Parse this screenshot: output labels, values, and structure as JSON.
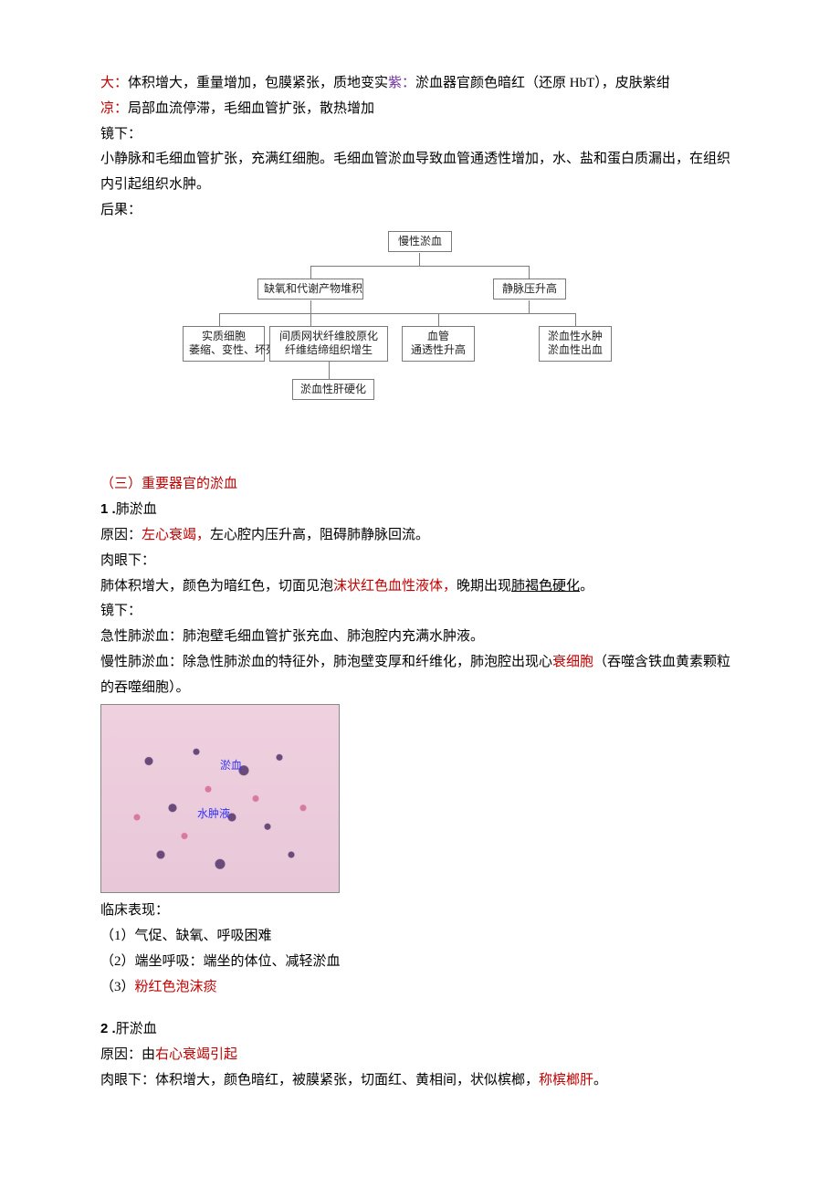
{
  "intro": {
    "line1_red": "大：",
    "line1_rest_a": "体积增大，重量增加，包膜紧张，质地变实",
    "line1_purp": "紫：",
    "line1_rest_b": "淤血器官颜色暗红（还原 HbT），皮肤紫绀",
    "line2_red": "凉：",
    "line2_rest": "局部血流停滞，毛细血管扩张，散热增加",
    "line3": "镜下：",
    "line4": "小静脉和毛细血管扩张，充满红细胞。毛细血管淤血导致血管通透性增加，水、盐和蛋白质漏出，在组织内引起组织水肿。",
    "line5": "后果："
  },
  "flowchart": {
    "top": "慢性淤血",
    "l2a": "缺氧和代谢产物堆积",
    "l2b": "静脉压升高",
    "l3a_1": "实质细胞",
    "l3a_2": "萎缩、变性、坏死",
    "l3b_1": "间质网状纤维胶原化",
    "l3b_2": "纤维结缔组织增生",
    "l3c_1": "血管",
    "l3c_2": "通透性升高",
    "l3d_1": "淤血性水肿",
    "l3d_2": "淤血性出血",
    "bottom": "淤血性肝硬化"
  },
  "section3": {
    "heading": "（三）重要器官的淤血",
    "item1_num": "1 .",
    "item1_title": "肺淤血",
    "cause_label": "原因：",
    "cause_red": "左心衰竭，",
    "cause_rest": "左心腔内压升高，阻碍肺静脉回流。",
    "gross_label": "肉眼下：",
    "gross_a": "肺体积增大，颜色为暗红色，切面见泡",
    "gross_red": "沫状红色血性液体，",
    "gross_b": "晚期出现",
    "gross_u": "肺褐色硬化",
    "gross_c": "。",
    "micro_label": "镜下：",
    "micro1": "急性肺淤血：肺泡壁毛细血管扩张充血、肺泡腔内充满水肿液。",
    "micro2_a": "慢性肺淤血：除急性肺淤血的特征外，肺泡壁变厚和纤维化，肺泡腔出现心",
    "micro2_red": "衰细胞",
    "micro2_b": "（吞噬含铁血黄素颗粒的吞噬细胞）。",
    "histo_lbl1": "淤血",
    "histo_lbl2": "水肿液",
    "clinical_label": "临床表现：",
    "c1": "（1）气促、缺氧、呼吸困难",
    "c2": "（2）端坐呼吸：端坐的体位、减轻淤血",
    "c3_a": "（3）",
    "c3_red": "粉红色泡沫痰",
    "item2_num": "2 .",
    "item2_title": "肝淤血",
    "cause2_label": "原因：由",
    "cause2_red": "右心衰竭引起",
    "gross2_label": "肉眼下：",
    "gross2_a": "体积增大，颜色暗红，被膜紧张，切面红、黄相间，状似槟榔，",
    "gross2_red": "称槟榔肝",
    "gross2_b": "。"
  }
}
